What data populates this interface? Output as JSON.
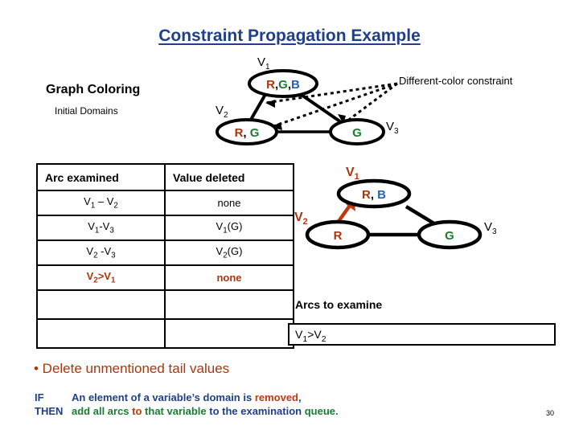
{
  "title": "Constraint Propagation Example",
  "headings": {
    "graph_coloring": "Graph Coloring",
    "initial_domains": "Initial Domains",
    "arcs_to_examine": "Arcs to examine"
  },
  "annotations": {
    "different_color_constraint": "Different-color constraint"
  },
  "graph_top": {
    "nodes": [
      {
        "id": "V1",
        "label": "V",
        "subscript": "1",
        "domain": [
          {
            "text": "R",
            "color": "#a8360e"
          },
          {
            "text": ",",
            "color": "#000000"
          },
          {
            "text": "G",
            "color": "#1d7a32"
          },
          {
            "text": ",",
            "color": "#000000"
          },
          {
            "text": "B",
            "color": "#2a63a8"
          }
        ]
      },
      {
        "id": "V2",
        "label": "V",
        "subscript": "2",
        "domain": [
          {
            "text": "R",
            "color": "#a8360e"
          },
          {
            "text": ",",
            "color": "#000000"
          },
          {
            "text": " G",
            "color": "#1d7a32"
          }
        ]
      },
      {
        "id": "V3",
        "label": "V",
        "subscript": "3",
        "domain": [
          {
            "text": "G",
            "color": "#1d7a32"
          }
        ]
      }
    ],
    "edges": [
      "V1-V2",
      "V1-V3",
      "V2-V3"
    ]
  },
  "graph_bottom": {
    "nodes": [
      {
        "id": "V1",
        "label": "V",
        "subscript": "1",
        "label_color": "#a8360e",
        "domain": [
          {
            "text": "R",
            "color": "#a8360e"
          },
          {
            "text": ",",
            "color": "#000000"
          },
          {
            "text": " B",
            "color": "#2a63a8"
          }
        ]
      },
      {
        "id": "V2",
        "label": "V",
        "subscript": "2",
        "label_color": "#a8360e",
        "domain": [
          {
            "text": "R",
            "color": "#a8360e"
          }
        ]
      },
      {
        "id": "V3",
        "label": "V",
        "subscript": "3",
        "label_color": "#000000",
        "domain": [
          {
            "text": "G",
            "color": "#1d7a32"
          }
        ]
      }
    ],
    "edges": [
      "V1-V3",
      "V2-V3"
    ],
    "arrow": {
      "from": "V2",
      "to": "V1",
      "color": "#c0390c"
    }
  },
  "table": {
    "columns": [
      "Arc  examined",
      "Value deleted"
    ],
    "rows": [
      {
        "arc": "V1 – V2",
        "value": "none",
        "highlight": false
      },
      {
        "arc": "V1-V3",
        "value": "V1(G)",
        "highlight": false
      },
      {
        "arc": "V2-V3",
        "value": "V2(G)",
        "highlight": false
      },
      {
        "arc": "V2>V1",
        "value": "none",
        "highlight": true
      },
      {
        "arc": "",
        "value": "",
        "highlight": false
      },
      {
        "arc": "",
        "value": "",
        "highlight": false
      }
    ]
  },
  "arcs_queue": {
    "items": [
      "V1>V2"
    ]
  },
  "bullet": "• Delete unmentioned tail values",
  "rule": {
    "if_keyword": "IF",
    "then_keyword": "THEN",
    "if_part1": "An element of a variable’s domain is ",
    "if_removed": "removed",
    "if_comma": ",",
    "then_part1": "add all arcs ",
    "then_to": "to",
    "then_part2": " that variable",
    "then_part3": " to the examination ",
    "then_queue": "queue."
  },
  "page_number": "30",
  "colors": {
    "title_blue": "#1f3f87",
    "red": "#a8360e",
    "green": "#1d7a32",
    "blue": "#2a63a8",
    "arrow_red": "#c0390c"
  }
}
